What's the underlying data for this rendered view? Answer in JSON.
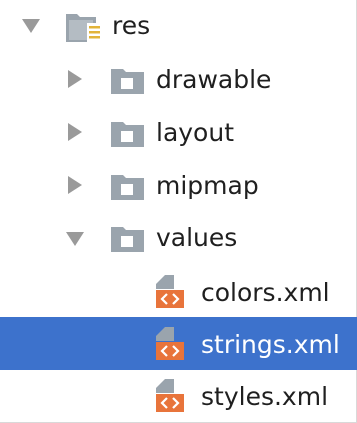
{
  "tree": {
    "root": {
      "label": "res",
      "icon": "resource-folder-icon",
      "expanded": true
    },
    "folders": [
      {
        "label": "drawable",
        "icon": "folder-icon",
        "expanded": false
      },
      {
        "label": "layout",
        "icon": "folder-icon",
        "expanded": false
      },
      {
        "label": "mipmap",
        "icon": "folder-icon",
        "expanded": false
      },
      {
        "label": "values",
        "icon": "folder-icon",
        "expanded": true
      }
    ],
    "files": [
      {
        "label": "colors.xml",
        "icon": "xml-file-icon",
        "selected": false
      },
      {
        "label": "strings.xml",
        "icon": "xml-file-icon",
        "selected": true
      },
      {
        "label": "styles.xml",
        "icon": "xml-file-icon",
        "selected": false
      }
    ]
  },
  "colors": {
    "selection": "#3d72cc",
    "folder": "#9aa4ad",
    "xml_accent": "#e8743b",
    "arrow": "#9a9a9a"
  }
}
